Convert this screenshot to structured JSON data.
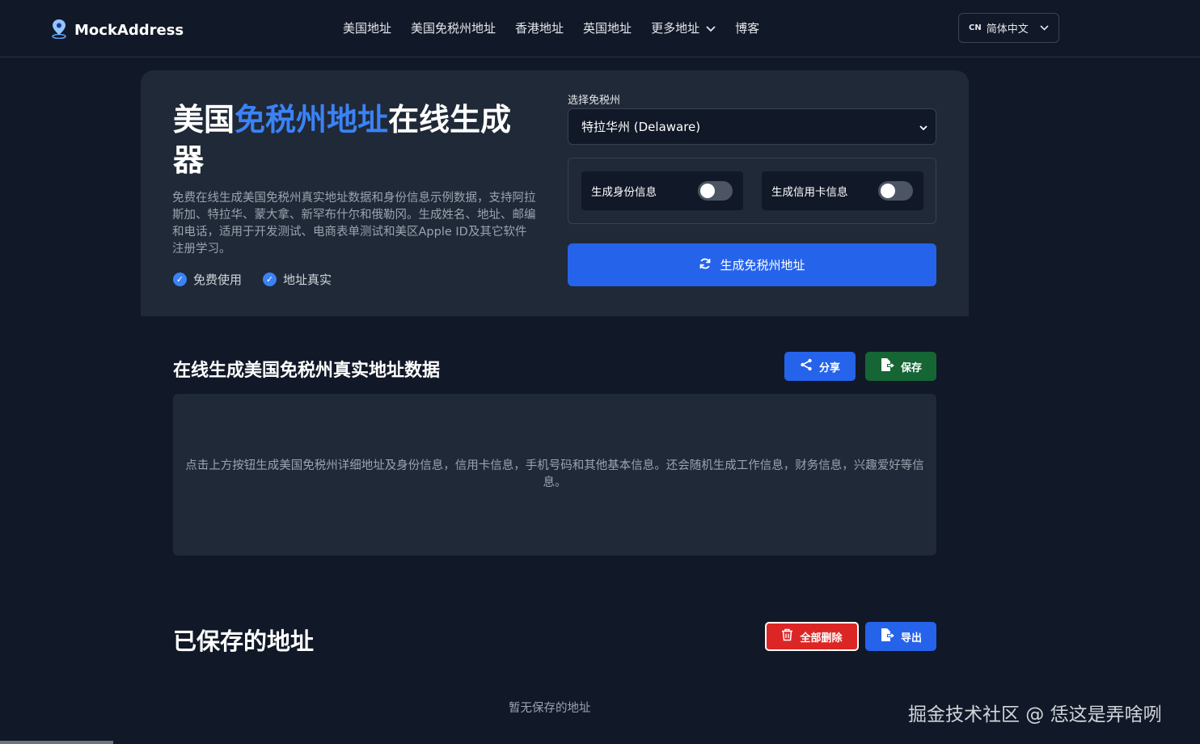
{
  "navbar": {
    "brand": "MockAddress",
    "links": [
      "美国地址",
      "美国免税州地址",
      "香港地址",
      "英国地址",
      "更多地址",
      "博客"
    ],
    "lang_code": "CN",
    "lang_label": "简体中文"
  },
  "hero": {
    "title_part1": "美国",
    "title_accent": "免税州地址",
    "title_part2": "在线生成器",
    "description": "免费在线生成美国免税州真实地址数据和身份信息示例数据，支持阿拉斯加、特拉华、蒙大拿、新罕布什尔和俄勒冈。生成姓名、地址、邮编和电话，适用于开发测试、电商表单测试和美区Apple ID及其它软件注册学习。",
    "features": [
      "免费使用",
      "地址真实"
    ],
    "state_label": "选择免税州",
    "state_selected": "特拉华州 (Delaware)",
    "toggle_identity": "生成身份信息",
    "toggle_card": "生成信用卡信息",
    "generate_button": "生成免税州地址"
  },
  "results": {
    "title": "在线生成美国免税州真实地址数据",
    "share_button": "分享",
    "save_button": "保存",
    "placeholder": "点击上方按钮生成美国免税州详细地址及身份信息，信用卡信息，手机号码和其他基本信息。还会随机生成工作信息，财务信息，兴趣爱好等信息。"
  },
  "saved": {
    "title": "已保存的地址",
    "delete_all_button": "全部删除",
    "export_button": "导出",
    "empty_text": "暂无保存的地址"
  },
  "watermark": "掘金技术社区 @ 恁这是弄啥咧",
  "colors": {
    "background": "#111827",
    "card": "#1f2937",
    "accent": "#3b82f6",
    "primary_button": "#2563eb",
    "save_button": "#166534",
    "danger_button": "#dc2626"
  },
  "icons": {
    "brand": "map-pin-icon",
    "dropdown": "chevron-down-icon",
    "check": "check-circle-icon",
    "generate": "refresh-icon",
    "share": "share-icon",
    "save": "file-export-icon",
    "delete": "trash-icon",
    "export": "file-export-icon"
  }
}
